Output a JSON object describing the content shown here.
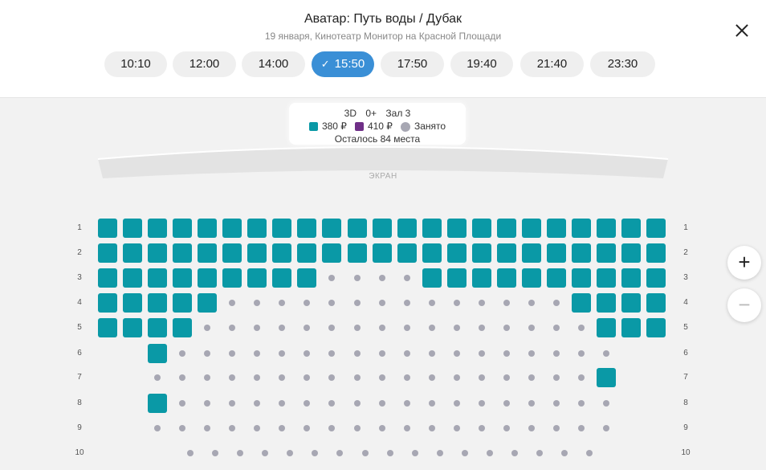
{
  "header": {
    "title": "Аватар: Путь воды / Дубак",
    "subtitle": "19 января,  Кинотеатр Монитор на Красной Площади"
  },
  "showtimes": [
    "10:10",
    "12:00",
    "14:00",
    "15:50",
    "17:50",
    "19:40",
    "21:40",
    "23:30"
  ],
  "selected_showtime": "15:50",
  "legend": {
    "format": "3D",
    "age": "0+",
    "hall": "Зал 3",
    "price1": "380 ₽",
    "price2": "410 ₽",
    "taken": "Занято",
    "remaining": "Осталось 84 места",
    "colors": {
      "price1": "#0a99a6",
      "price2": "#6f2f87",
      "taken": "#a7a7b3",
      "accent": "#3a8fd6"
    }
  },
  "screen_label": "ЭКРАН",
  "rows": [
    {
      "label": "1",
      "seats": "AAAAAAAAAAAAAAAAAAAAAAA"
    },
    {
      "label": "2",
      "seats": "AAAAAAAAAAAAAAAAAAAAAAA"
    },
    {
      "label": "3",
      "seats": "AAAAAAAAATTTTAAAAAAAAAA"
    },
    {
      "label": "4",
      "seats": "AAAAATTTTTTTTTTTTTTAAAA"
    },
    {
      "label": "5",
      "seats": "AAAATTTTTTTTTTTTTTTTAAA"
    },
    {
      "label": "6",
      "seats": "__ATTTTTTTTTTTTTTTTTT__"
    },
    {
      "label": "7",
      "seats": "__TTTTTTTTTTTTTTTTTTA__"
    },
    {
      "label": "8",
      "seats": "__ATTTTTTTTTTTTTTTTTT__"
    },
    {
      "label": "9",
      "seats": "__TTTTTTTTTTTTTTTTTTT__"
    },
    {
      "label": "10",
      "seats": "___TTTTTTTTTTTTTTTTT___"
    }
  ],
  "zoom": {
    "in": "+",
    "out": "−"
  },
  "icons": {
    "close": "close-icon",
    "check": "check-icon"
  }
}
